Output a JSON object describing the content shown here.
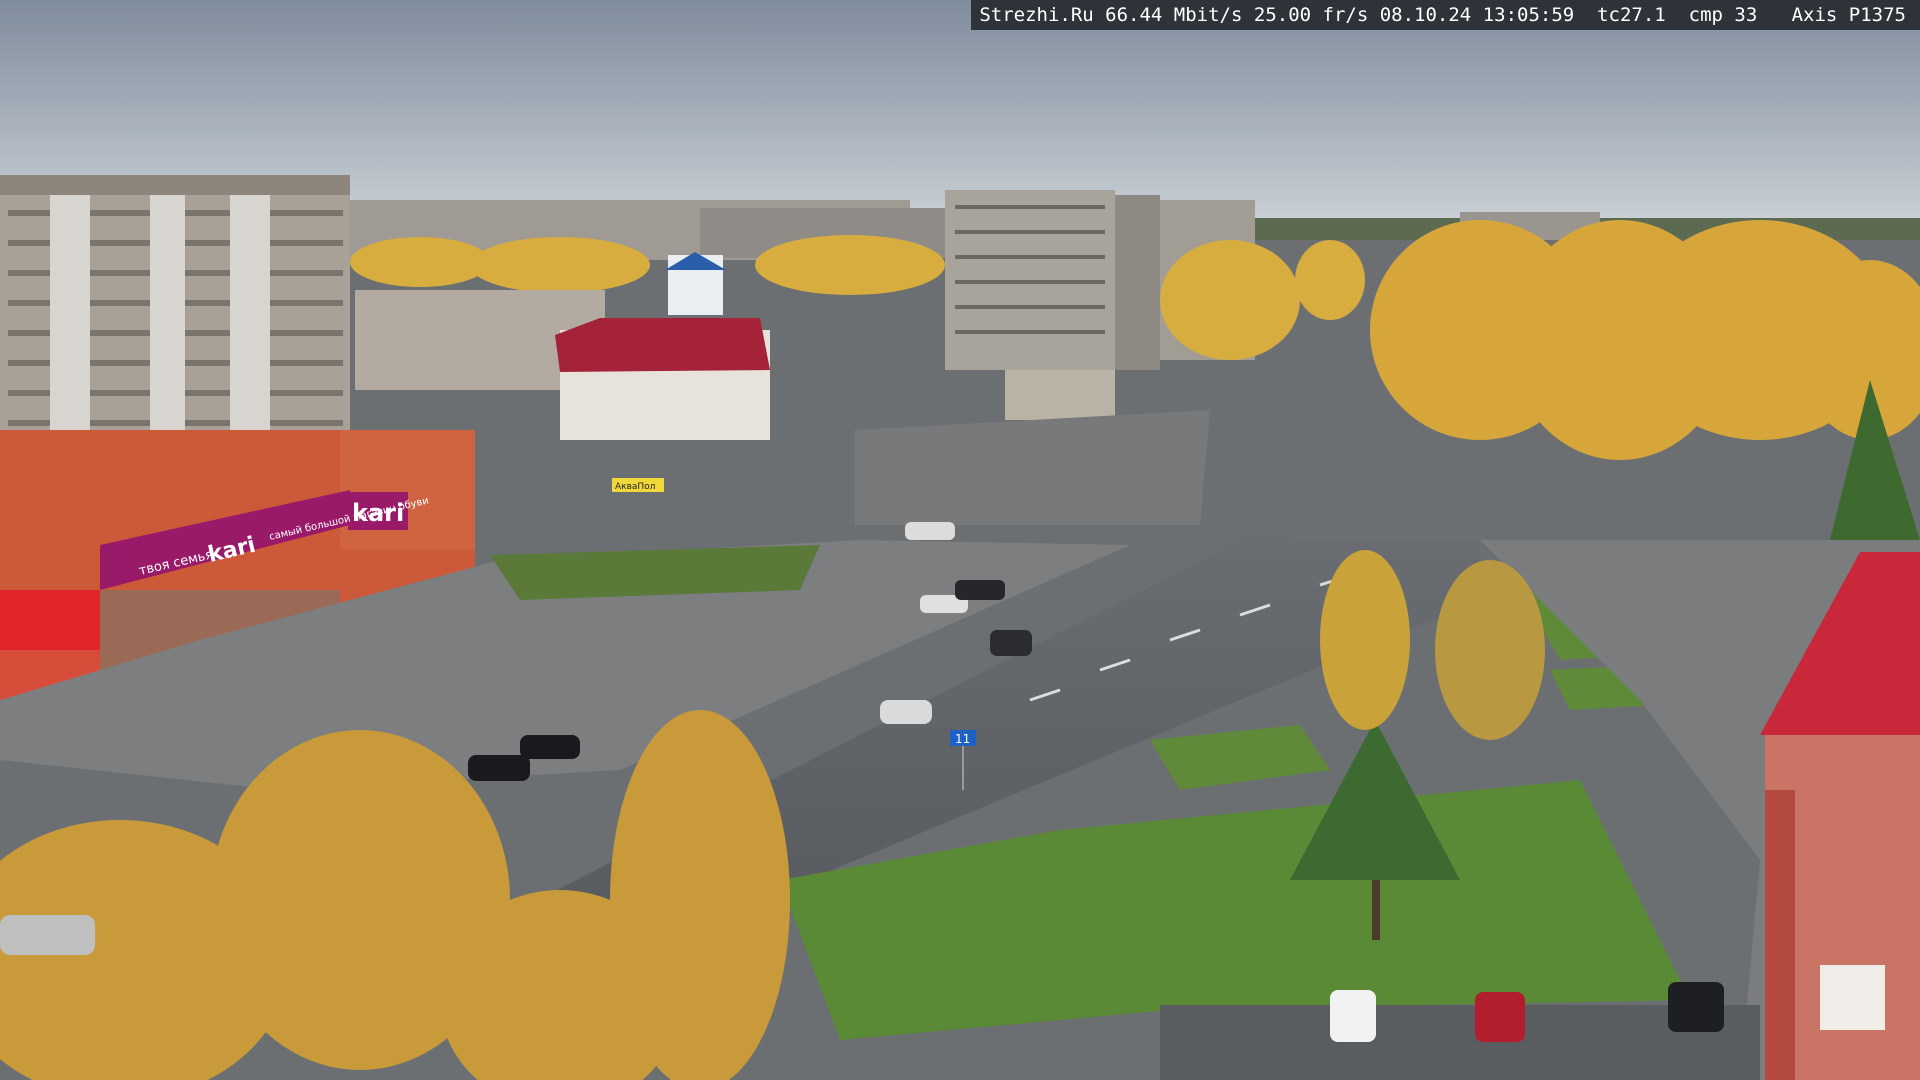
{
  "overlay": {
    "site": "Strezhi.Ru",
    "bitrate": "66.44 Mbit/s",
    "framerate": "25.00 fr/s",
    "date": "08.10.24",
    "time": "13:05:59",
    "tc": "tc27.1",
    "cmp": "cmp 33",
    "camera": "Axis P1375"
  },
  "signs": {
    "store_brand": "kari",
    "store_slogan_left": "твоя семья",
    "store_brand_lower": "kari",
    "store_tagline": "самый большой магазин обуви",
    "road_sign": "11",
    "small_sign": "АкваПол"
  },
  "colors": {
    "sky_top": "#8a97a6",
    "sky_bottom": "#c9d0d6",
    "asphalt": "#5b5f63",
    "grass": "#5f8a3a",
    "foliage": "#d8a83a",
    "store_magenta": "#9a1a6a",
    "roof_red": "#b3243a"
  }
}
